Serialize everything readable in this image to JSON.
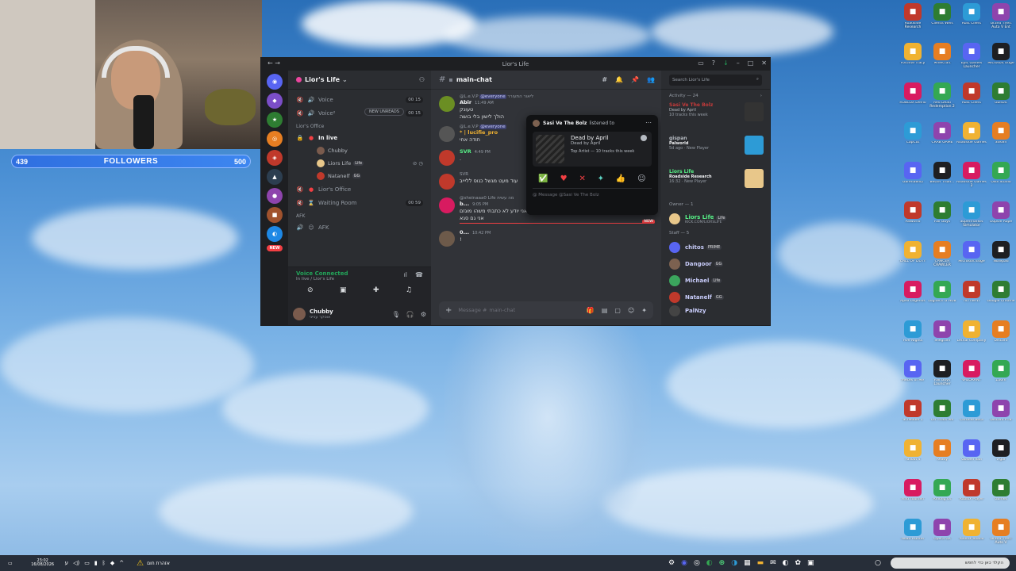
{
  "stream": {
    "followers_current": "439",
    "followers_label": "FOLLOWERS",
    "followers_goal": "500"
  },
  "discord": {
    "window_title": "Lior's Life",
    "server_name": "Lior's Life",
    "new_unreads": "NEW UNREADS",
    "new_badge": "NEW",
    "channels": {
      "voice1": "Voice",
      "voice1_count": "00 15",
      "voice2": "Voice²",
      "voice2_count": "00 15",
      "cat_office": "Lior's Office",
      "in_live": "In live",
      "lior_office": "Lior's Office",
      "waiting_room": "Waiting Room",
      "waiting_count": "00 59",
      "cat_afk": "AFK",
      "afk": "AFK"
    },
    "voice_members": [
      {
        "name": "Chubby",
        "tag": ""
      },
      {
        "name": "Liors Life",
        "tag": "Life"
      },
      {
        "name": "Natanelf",
        "tag": "GG"
      }
    ],
    "voice_panel": {
      "status": "Voice Connected",
      "sub": "In live / Lior's Life"
    },
    "user": {
      "name": "Chubby",
      "status": "אוסקר ענייני"
    },
    "chat": {
      "channel": "main-chat",
      "composer_placeholder": "Message #",
      "composer_channel": "main-chat",
      "new_marker": "NEW",
      "messages": [
        {
          "reply_user": "@L.e.V.P",
          "reply_ping": "@everyone",
          "reply_text": "ליאור התעורר",
          "author": "Abir",
          "time": "11:49 AM",
          "lines": [
            "טעונק",
            "הולך לישון בלי בושה"
          ]
        },
        {
          "reply_user": "@L.e.V.P",
          "reply_ping": "@everyone",
          "reply_text": "",
          "author": "* | lucifie_pro",
          "time": "",
          "lines": [
            "תודה אחי"
          ]
        },
        {
          "reply_user": "",
          "reply_ping": "",
          "reply_text": "",
          "author": "SVR",
          "time": "4:49 PM",
          "lines": [
            "."
          ]
        },
        {
          "reply_user": "SVR",
          "reply_ping": "",
          "reply_text": "",
          "author": "",
          "time": "",
          "lines": [
            "עוד מעט מגשל כנוס לליייב"
          ]
        },
        {
          "reply_user": "@sheinaaa0",
          "reply_ping": "",
          "reply_text": "Life מה עשית",
          "author": "b...",
          "time": "9:05 PM",
          "lines": [
            "סתם אגלו עלי תסביך אני יודע לא כתבתי משהו מוגזם",
            "אני גם סגא"
          ]
        },
        {
          "reply_user": "",
          "reply_ping": "",
          "reply_text": "",
          "author": "0...",
          "time": "10:42 PM",
          "lines": [
            "!"
          ]
        }
      ]
    },
    "popup": {
      "user": "Sasi Ve The Bolz",
      "action": "listened to",
      "track": "Dead by April",
      "artist": "Dead by April",
      "badge": "Top Artist — 10 tracks this week",
      "message_placeholder": "Message @Sasi Ve The Bolz",
      "reactions": [
        "✅",
        "♥",
        "✕",
        "✦",
        "👍",
        "☺"
      ]
    },
    "members": {
      "search_placeholder": "Search Lior's Life",
      "activity_label": "Activity — 24",
      "activity": [
        {
          "name": "Sasi Ve The Bolz",
          "game": "Dead by April",
          "sub": "10 tracks this week",
          "color": "#c23a3a"
        },
        {
          "name": "gispan",
          "game": "Palworld",
          "sub": "5d ago  ·  New Player",
          "color": "#2d9bd6"
        },
        {
          "name": "Liors Life",
          "game": "Roadside Research",
          "sub": "16:32  ·  New Player",
          "color": "#e8c78a"
        }
      ],
      "owner_label": "Owner — 1",
      "owner": {
        "name": "Liors Life",
        "tag": "Life",
        "sub": "KICK.COM/LIORSLIFE"
      },
      "staff_label": "Staff — 5",
      "staff": [
        {
          "name": "chitos",
          "tag": "PRIME",
          "color": "#c9cdfb"
        },
        {
          "name": "Dangoor",
          "tag": "GG",
          "color": "#c9cdfb"
        },
        {
          "name": "Michael",
          "tag": "Life",
          "color": "#c9cdfb"
        },
        {
          "name": "Natanelf",
          "tag": "GG",
          "color": "#c9cdfb"
        },
        {
          "name": "PalNzy",
          "tag": "",
          "color": "#c9cdfb"
        }
      ]
    }
  },
  "desktop_icons": [
    "Roadside Research",
    "Clients Wels",
    "Rust Client",
    "Grand Theft Auto V Ent",
    "Fortnite Tracy",
    "Minecraft",
    "Epic Games Launcher",
    "Microsoft Edge",
    "ROBLOX Demo",
    "Red Dead Redemption 2",
    "Rust Client",
    "Ubisoft",
    "CapCut",
    "CRAB GAME",
    "Roadside Games",
    "Steam",
    "GarenaBlitz",
    "Better Than...",
    "Roadside Games 2",
    "OBS Studio",
    "Palworld",
    "Fall Guys",
    "Supermarket Simulator",
    "Oopsie Rope",
    "CALL OF DUTY",
    "CANCER CRAWLER",
    "Microsoft Edge",
    "Notepad",
    "Apex Legends",
    "Logitech G HUB",
    "נגישות כוח",
    "Google Chrome",
    "Five Nights",
    "Telegram",
    "Lethal Company",
    "Discord",
    "Pieces of Me",
    "Fall Guys Launcher",
    "VALORANT",
    "Zoom",
    "Schedule 1",
    "Oh Thats Me",
    "Chrome Beta",
    "Discord PTB",
    "Fallout 4",
    "Ready",
    "Golden Idol",
    "Vigor",
    "Find Yourself",
    "Among Us",
    "Roblox Player",
    "Games",
    "Head Hunter",
    "Opera GX",
    "Roblox Studio",
    "Grand Theft Auto V"
  ],
  "taskbar": {
    "time": "23:02",
    "date": "16/08/2026",
    "warning": "אזהרת חום",
    "search": "הקלד כאן כדי לחפש"
  },
  "colors": {
    "discord_bg": "#313338",
    "discord_sidebar": "#2b2d31",
    "discord_dark": "#1e1f22",
    "accent_green": "#23a55a",
    "accent_red": "#f23f43",
    "followers_bar": "#3d86f0"
  }
}
